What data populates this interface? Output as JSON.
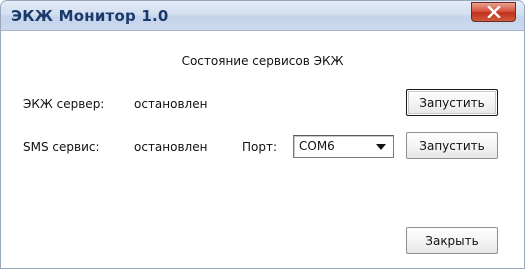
{
  "window": {
    "title": "ЭКЖ Монитор 1.0",
    "close_icon": "close-icon"
  },
  "panel": {
    "heading": "Состояние сервисов ЭКЖ"
  },
  "ekzh_server": {
    "label": "ЭКЖ сервер:",
    "status": "остановлен",
    "start_label": "Запустить"
  },
  "sms_service": {
    "label": "SMS сервис:",
    "status": "остановлен",
    "port_label": "Порт:",
    "port_value": "COM6",
    "start_label": "Запустить"
  },
  "footer": {
    "close_label": "Закрыть"
  },
  "colors": {
    "title_text": "#1b3a6b",
    "close_button": "#c0321d"
  }
}
